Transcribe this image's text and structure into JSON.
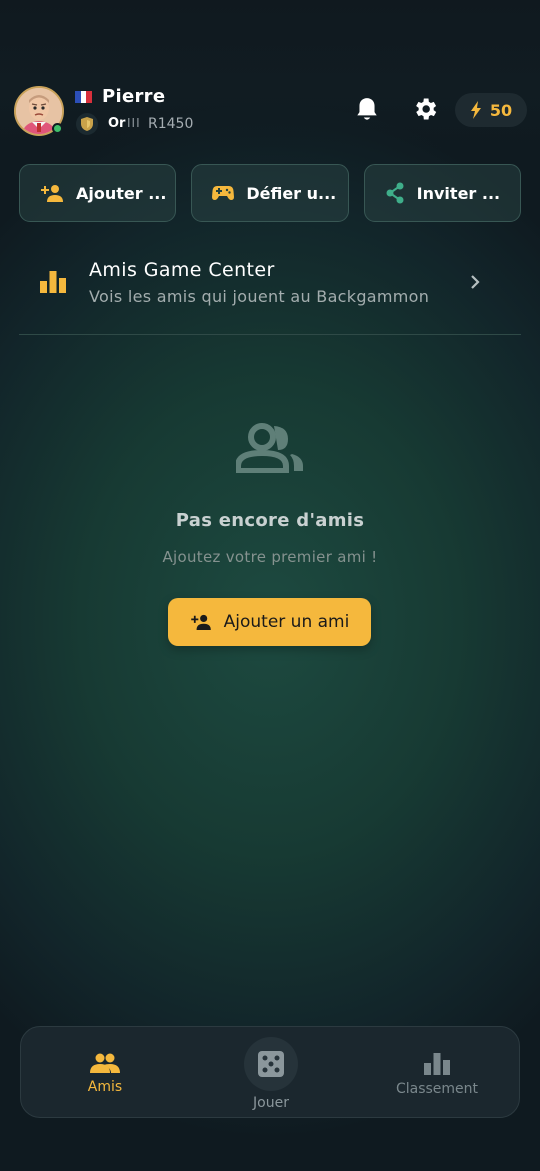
{
  "header": {
    "username": "Pierre",
    "rank_name": "Or",
    "rank_tier": "III",
    "rating": "R1450",
    "energy": "50",
    "accent_color": "#f5b83d",
    "online_color": "#3fbf6a"
  },
  "actions": [
    {
      "label": "Ajouter ...",
      "icon": "person-add-icon"
    },
    {
      "label": "Défier u...",
      "icon": "gamepad-icon"
    },
    {
      "label": "Inviter ...",
      "icon": "share-icon"
    }
  ],
  "game_center": {
    "title": "Amis Game Center",
    "subtitle": "Vois les amis qui jouent au Backgammon",
    "icon": "bar-chart-icon"
  },
  "empty_state": {
    "title": "Pas encore d'amis",
    "subtitle": "Ajoutez votre premier ami !",
    "button_label": "Ajouter un ami",
    "icon": "people-icon"
  },
  "bottom_nav": {
    "items": [
      {
        "label": "Amis",
        "icon": "people-icon",
        "active": true
      },
      {
        "label": "Jouer",
        "icon": "dice-icon",
        "active": false
      },
      {
        "label": "Classement",
        "icon": "bar-chart-icon",
        "active": false
      }
    ]
  }
}
